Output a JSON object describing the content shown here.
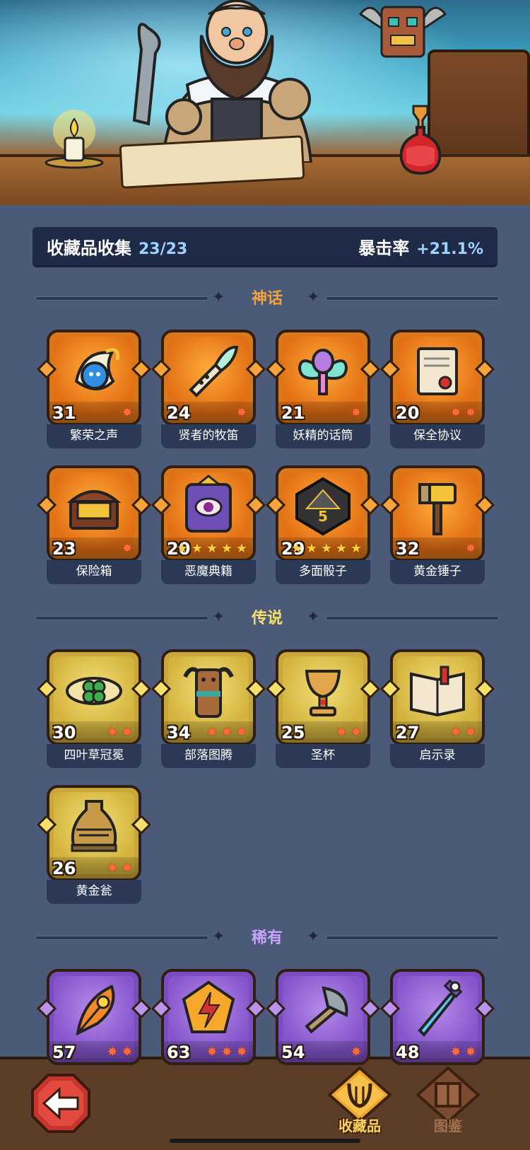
{
  "summary": {
    "label": "收藏品收集",
    "value": "23/23",
    "crit_label": "暴击率",
    "crit_value": "+21.1%"
  },
  "sections": {
    "mythic": "神话",
    "legendary": "传说",
    "rare": "稀有"
  },
  "mythic_items": [
    {
      "name": "繁荣之声",
      "level": "31",
      "stars": 1,
      "star_color": "red",
      "icon": "blue-spirit-icon"
    },
    {
      "name": "贤者的牧笛",
      "level": "24",
      "stars": 1,
      "star_color": "red",
      "icon": "flute-icon"
    },
    {
      "name": "妖精的话筒",
      "level": "21",
      "stars": 1,
      "star_color": "red",
      "icon": "fairy-microphone-icon"
    },
    {
      "name": "保全协议",
      "level": "20",
      "stars": 2,
      "star_color": "red",
      "icon": "contract-scroll-icon"
    },
    {
      "name": "保险箱",
      "level": "23",
      "stars": 1,
      "star_color": "red",
      "icon": "treasure-chest-icon"
    },
    {
      "name": "恶魔典籍",
      "level": "20",
      "stars": 5,
      "star_color": "gold",
      "icon": "demon-book-icon"
    },
    {
      "name": "多面骰子",
      "level": "29",
      "stars": 5,
      "star_color": "gold",
      "icon": "dice-icon"
    },
    {
      "name": "黄金锤子",
      "level": "32",
      "stars": 1,
      "star_color": "red",
      "icon": "golden-hammer-icon"
    }
  ],
  "legendary_items": [
    {
      "name": "四叶草冠冕",
      "level": "30",
      "stars": 2,
      "star_color": "red",
      "icon": "clover-crown-icon"
    },
    {
      "name": "部落图腾",
      "level": "34",
      "stars": 3,
      "star_color": "red",
      "icon": "tribal-totem-icon"
    },
    {
      "name": "圣杯",
      "level": "25",
      "stars": 2,
      "star_color": "red",
      "icon": "grail-icon"
    },
    {
      "name": "启示录",
      "level": "27",
      "stars": 2,
      "star_color": "red",
      "icon": "open-book-icon"
    },
    {
      "name": "黄金瓮",
      "level": "26",
      "stars": 2,
      "star_color": "red",
      "icon": "golden-urn-icon"
    }
  ],
  "rare_items": [
    {
      "level": "57",
      "stars": 2,
      "star_color": "red",
      "icon": "fire-feather-icon"
    },
    {
      "level": "63",
      "stars": 3,
      "star_color": "red",
      "icon": "lightning-gem-icon"
    },
    {
      "level": "54",
      "stars": 1,
      "star_color": "red",
      "icon": "battle-axe-icon"
    },
    {
      "level": "48",
      "stars": 2,
      "star_color": "red",
      "icon": "ice-sword-icon"
    }
  ],
  "nav": {
    "collection_label": "收藏品",
    "catalog_label": "图鉴"
  },
  "colors": {
    "page_bg": "#4a5a78",
    "mythic": "#d9771c",
    "legendary": "#c9a73a",
    "rare": "#7b4cbf",
    "mythic_title": "#f4a23a",
    "legendary_title": "#f5e06b",
    "rare_title": "#c9a3ff"
  }
}
